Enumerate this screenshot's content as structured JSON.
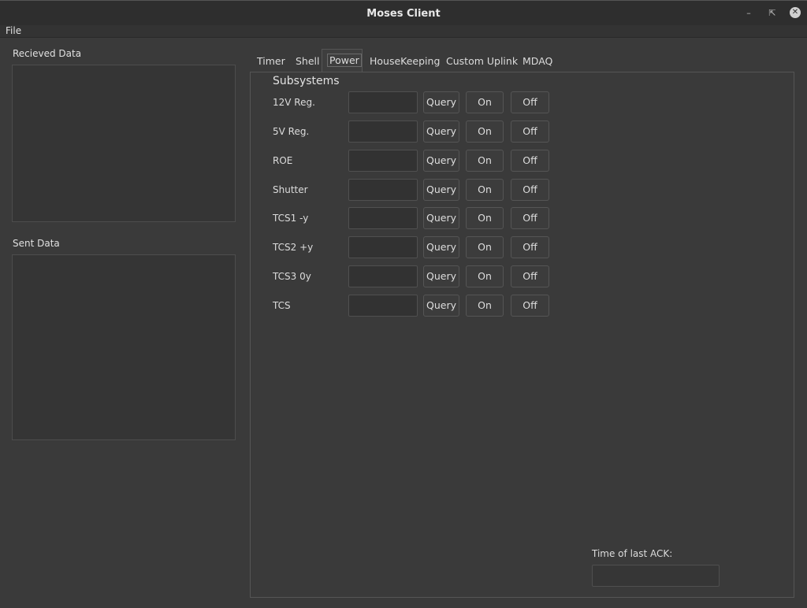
{
  "window": {
    "title": "Moses Client",
    "buttons": [
      "minimize",
      "maximize",
      "close"
    ]
  },
  "menu": {
    "file": "File"
  },
  "left": {
    "received_label": "Recieved Data",
    "sent_label": "Sent Data"
  },
  "tabs": [
    {
      "label": "Timer"
    },
    {
      "label": "Shell"
    },
    {
      "label": "Power",
      "active": true
    },
    {
      "label": "HouseKeeping"
    },
    {
      "label": "Custom Uplink"
    },
    {
      "label": "MDAQ"
    }
  ],
  "power": {
    "group_title": "Subsystems",
    "buttons": {
      "query": "Query",
      "on": "On",
      "off": "Off"
    },
    "rows": [
      {
        "label": "12V Reg.",
        "value": ""
      },
      {
        "label": "5V Reg.",
        "value": ""
      },
      {
        "label": "ROE",
        "value": ""
      },
      {
        "label": "Shutter",
        "value": ""
      },
      {
        "label": "TCS1 -y",
        "value": ""
      },
      {
        "label": "TCS2 +y",
        "value": ""
      },
      {
        "label": "TCS3 0y",
        "value": ""
      },
      {
        "label": "TCS",
        "value": ""
      }
    ],
    "ack_label": "Time of last ACK:",
    "ack_value": ""
  }
}
